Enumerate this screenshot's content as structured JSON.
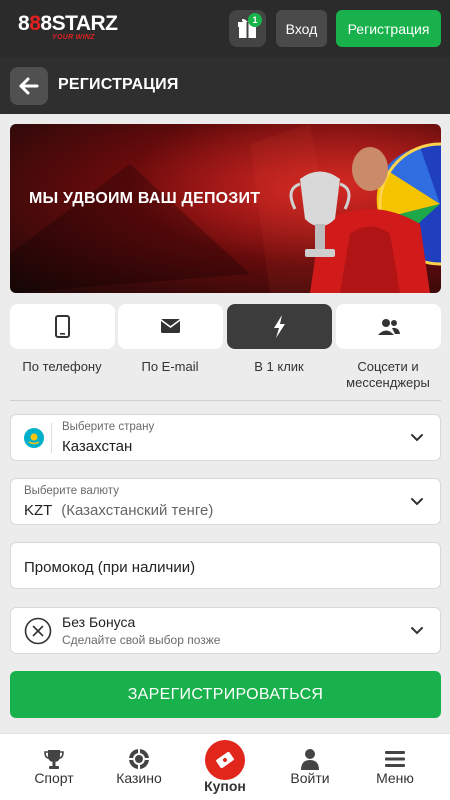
{
  "topbar": {
    "logo_text_a": "8",
    "logo_text_b": "8",
    "logo_text_c": "8",
    "logo_text_d": "STARZ",
    "logo_tagline": "YOUR WINZ",
    "gift_badge": "1",
    "login_label": "Вход",
    "register_label": "Регистрация"
  },
  "page": {
    "title": "РЕГИСТРАЦИЯ"
  },
  "banner": {
    "headline": "МЫ УДВОИМ ВАШ ДЕПОЗИТ"
  },
  "methods": [
    {
      "label": "По телефону",
      "icon": "phone-icon"
    },
    {
      "label": "По E-mail",
      "icon": "envelope-icon"
    },
    {
      "label": "В 1 клик",
      "icon": "lightning-icon",
      "active": true
    },
    {
      "label": "Соцсети и мессенджеры",
      "icon": "users-icon"
    }
  ],
  "form": {
    "country_label": "Выберите страну",
    "country_value": "Казахстан",
    "currency_label": "Выберите валюту",
    "currency_code": "KZT",
    "currency_name": "(Казахстанский тенге)",
    "promo_placeholder": "Промокод (при наличии)",
    "bonus_title": "Без Бонуса",
    "bonus_subtitle": "Сделайте свой выбор позже",
    "submit_label": "ЗАРЕГИСТРИРОВАТЬСЯ"
  },
  "nav": [
    {
      "label": "Спорт",
      "icon": "trophy-icon"
    },
    {
      "label": "Казино",
      "icon": "chip-icon"
    },
    {
      "label": "Купон",
      "icon": "ticket-icon"
    },
    {
      "label": "Войти",
      "icon": "user-icon"
    },
    {
      "label": "Меню",
      "icon": "hamburger-icon"
    }
  ],
  "colors": {
    "accent_green": "#18b14b",
    "brand_red": "#e1261c",
    "topbar": "#2b2b2b"
  }
}
